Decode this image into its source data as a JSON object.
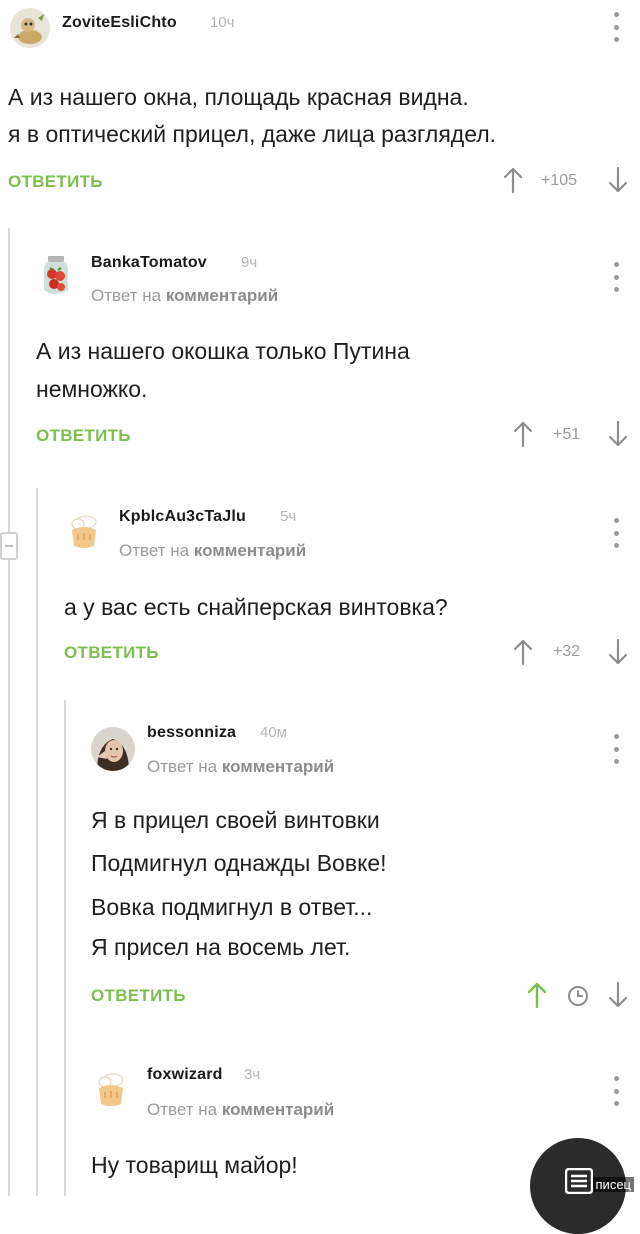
{
  "comments": [
    {
      "username": "ZoviteEsliChto",
      "time": "10ч",
      "reply_to_prefix": "",
      "reply_to_bold": "",
      "lines": [
        "А из нашего окна, площадь красная видна.",
        "я в оптический прицел, даже лица разглядел."
      ],
      "reply_label": "ОТВЕТИТЬ",
      "rating": "+105",
      "avatar": "cartoon-figure"
    },
    {
      "username": "BankaTomatov",
      "time": "9ч",
      "reply_to_prefix": "Ответ на ",
      "reply_to_bold": "комментарий",
      "lines": [
        "А из нашего окошка только Путина",
        "немножко."
      ],
      "reply_label": "ОТВЕТИТЬ",
      "rating": "+51",
      "avatar": "tomato-jar"
    },
    {
      "username": "KpblcAu3cTaJlu",
      "time": "5ч",
      "reply_to_prefix": "Ответ на ",
      "reply_to_bold": "комментарий",
      "lines": [
        "а у вас есть снайперская винтовка?"
      ],
      "reply_label": "ОТВЕТИТЬ",
      "rating": "+32",
      "avatar": "default-chef"
    },
    {
      "username": "bessonniza",
      "time": "40м",
      "reply_to_prefix": "Ответ на ",
      "reply_to_bold": "комментарий",
      "lines": [
        "Я в прицел своей винтовки",
        "Подмигнул однажды Вовке!",
        "Вовка подмигнул в ответ...",
        "Я присел на восемь лет."
      ],
      "reply_label": "ОТВЕТИТЬ",
      "rating": "",
      "avatar": "woman-photo"
    },
    {
      "username": "foxwizard",
      "time": "3ч",
      "reply_to_prefix": "Ответ на ",
      "reply_to_bold": "комментарий",
      "lines": [
        "Ну товарищ майор!"
      ],
      "reply_label": "",
      "rating": "",
      "avatar": "default-chef"
    }
  ],
  "watermark": "писец",
  "icons": {
    "upvote": "arrow-up-icon",
    "downvote": "arrow-down-icon",
    "menu": "more-vertical-icon",
    "pending": "clock-icon",
    "fab": "comments-list-icon"
  },
  "colors": {
    "accent": "#7cbf4f",
    "meta": "#9a9a9a",
    "text": "#1f1f1f"
  }
}
